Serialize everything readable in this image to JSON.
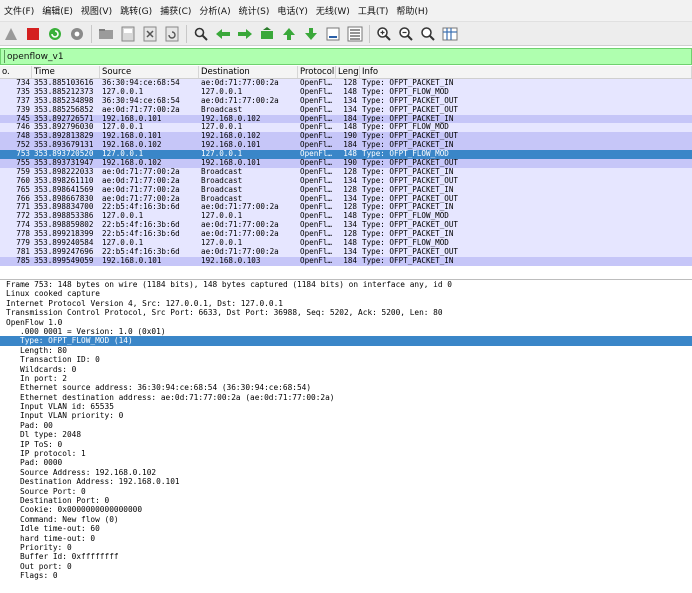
{
  "menubar": {
    "items": [
      "文件(F)",
      "编辑(E)",
      "视图(V)",
      "跳转(G)",
      "捕获(C)",
      "分析(A)",
      "统计(S)",
      "电话(Y)",
      "无线(W)",
      "工具(T)",
      "帮助(H)"
    ]
  },
  "toolbar": {
    "icons": [
      "shark-fin-icon",
      "stop-icon",
      "restart-icon",
      "options-icon",
      "open-icon",
      "save-icon",
      "close-file-icon",
      "reload-icon",
      "find-icon",
      "back-icon",
      "forward-icon",
      "goto-icon",
      "first-icon",
      "last-icon",
      "autoscroll-icon",
      "colorize-icon",
      "zoom-in-icon",
      "zoom-out-icon",
      "zoom-reset-icon",
      "resize-columns-icon"
    ]
  },
  "filter": {
    "value": "openflow_v1"
  },
  "packet_list": {
    "columns": [
      "o.",
      "Time",
      "Source",
      "Destination",
      "Protocol",
      "Length",
      "Info"
    ],
    "rows": [
      {
        "no": "734",
        "time": "353.885103616",
        "src": "36:30:94:ce:68:54",
        "dst": "ae:0d:71:77:00:2a",
        "proto": "OpenFl…",
        "len": "128",
        "info": "Type: OFPT_PACKET_IN",
        "style": "light"
      },
      {
        "no": "735",
        "time": "353.885212373",
        "src": "127.0.0.1",
        "dst": "127.0.0.1",
        "proto": "OpenFl…",
        "len": "148",
        "info": "Type: OFPT_FLOW_MOD",
        "style": "light"
      },
      {
        "no": "737",
        "time": "353.885234898",
        "src": "36:30:94:ce:68:54",
        "dst": "ae:0d:71:77:00:2a",
        "proto": "OpenFl…",
        "len": "134",
        "info": "Type: OFPT_PACKET_OUT",
        "style": "light"
      },
      {
        "no": "739",
        "time": "353.885256852",
        "src": "ae:0d:71:77:00:2a",
        "dst": "Broadcast",
        "proto": "OpenFl…",
        "len": "134",
        "info": "Type: OFPT_PACKET_OUT",
        "style": "light"
      },
      {
        "no": "745",
        "time": "353.892726571",
        "src": "192.168.0.101",
        "dst": "192.168.0.102",
        "proto": "OpenFl…",
        "len": "184",
        "info": "Type: OFPT_PACKET_IN",
        "style": "lav"
      },
      {
        "no": "746",
        "time": "353.892796030",
        "src": "127.0.0.1",
        "dst": "127.0.0.1",
        "proto": "OpenFl…",
        "len": "148",
        "info": "Type: OFPT_FLOW_MOD",
        "style": "light"
      },
      {
        "no": "748",
        "time": "353.892813829",
        "src": "192.168.0.101",
        "dst": "192.168.0.102",
        "proto": "OpenFl…",
        "len": "190",
        "info": "Type: OFPT_PACKET_OUT",
        "style": "lav"
      },
      {
        "no": "752",
        "time": "353.893679131",
        "src": "192.168.0.102",
        "dst": "192.168.0.101",
        "proto": "OpenFl…",
        "len": "184",
        "info": "Type: OFPT_PACKET_IN",
        "style": "lav"
      },
      {
        "no": "753",
        "time": "353.893720520",
        "src": "127.0.0.1",
        "dst": "127.0.0.1",
        "proto": "OpenFl…",
        "len": "148",
        "info": "Type: OFPT_FLOW_MOD",
        "style": "sel"
      },
      {
        "no": "755",
        "time": "353.893731947",
        "src": "192.168.0.102",
        "dst": "192.168.0.101",
        "proto": "OpenFl…",
        "len": "190",
        "info": "Type: OFPT_PACKET_OUT",
        "style": "lav"
      },
      {
        "no": "759",
        "time": "353.898222033",
        "src": "ae:0d:71:77:00:2a",
        "dst": "Broadcast",
        "proto": "OpenFl…",
        "len": "128",
        "info": "Type: OFPT_PACKET_IN",
        "style": "light"
      },
      {
        "no": "760",
        "time": "353.898261110",
        "src": "ae:0d:71:77:00:2a",
        "dst": "Broadcast",
        "proto": "OpenFl…",
        "len": "134",
        "info": "Type: OFPT_PACKET_OUT",
        "style": "light"
      },
      {
        "no": "765",
        "time": "353.898641569",
        "src": "ae:0d:71:77:00:2a",
        "dst": "Broadcast",
        "proto": "OpenFl…",
        "len": "128",
        "info": "Type: OFPT_PACKET_IN",
        "style": "light"
      },
      {
        "no": "766",
        "time": "353.898667830",
        "src": "ae:0d:71:77:00:2a",
        "dst": "Broadcast",
        "proto": "OpenFl…",
        "len": "134",
        "info": "Type: OFPT_PACKET_OUT",
        "style": "light"
      },
      {
        "no": "771",
        "time": "353.898834700",
        "src": "22:b5:4f:16:3b:6d",
        "dst": "ae:0d:71:77:00:2a",
        "proto": "OpenFl…",
        "len": "128",
        "info": "Type: OFPT_PACKET_IN",
        "style": "light"
      },
      {
        "no": "772",
        "time": "353.898853386",
        "src": "127.0.0.1",
        "dst": "127.0.0.1",
        "proto": "OpenFl…",
        "len": "148",
        "info": "Type: OFPT_FLOW_MOD",
        "style": "light"
      },
      {
        "no": "774",
        "time": "353.898859802",
        "src": "22:b5:4f:16:3b:6d",
        "dst": "ae:0d:71:77:00:2a",
        "proto": "OpenFl…",
        "len": "134",
        "info": "Type: OFPT_PACKET_OUT",
        "style": "light"
      },
      {
        "no": "778",
        "time": "353.899218399",
        "src": "22:b5:4f:16:3b:6d",
        "dst": "ae:0d:71:77:00:2a",
        "proto": "OpenFl…",
        "len": "128",
        "info": "Type: OFPT_PACKET_IN",
        "style": "light"
      },
      {
        "no": "779",
        "time": "353.899240584",
        "src": "127.0.0.1",
        "dst": "127.0.0.1",
        "proto": "OpenFl…",
        "len": "148",
        "info": "Type: OFPT_FLOW_MOD",
        "style": "light"
      },
      {
        "no": "781",
        "time": "353.899247696",
        "src": "22:b5:4f:16:3b:6d",
        "dst": "ae:0d:71:77:00:2a",
        "proto": "OpenFl…",
        "len": "134",
        "info": "Type: OFPT_PACKET_OUT",
        "style": "light"
      },
      {
        "no": "785",
        "time": "353.899549059",
        "src": "192.168.0.101",
        "dst": "192.168.0.103",
        "proto": "OpenFl…",
        "len": "184",
        "info": "Type: OFPT_PACKET_IN",
        "style": "lav"
      }
    ]
  },
  "details": {
    "lines": [
      {
        "text": "Frame 753: 148 bytes on wire (1184 bits), 148 bytes captured (1184 bits) on interface any, id 0",
        "indent": false,
        "sel": false
      },
      {
        "text": "Linux cooked capture",
        "indent": false,
        "sel": false
      },
      {
        "text": "Internet Protocol Version 4, Src: 127.0.0.1, Dst: 127.0.0.1",
        "indent": false,
        "sel": false
      },
      {
        "text": "Transmission Control Protocol, Src Port: 6633, Dst Port: 36988, Seq: 5202, Ack: 5200, Len: 80",
        "indent": false,
        "sel": false
      },
      {
        "text": "OpenFlow 1.0",
        "indent": false,
        "sel": false
      },
      {
        "text": ".000 0001 = Version: 1.0 (0x01)",
        "indent": true,
        "sel": false
      },
      {
        "text": "Type: OFPT_FLOW_MOD (14)",
        "indent": true,
        "sel": true
      },
      {
        "text": "Length: 80",
        "indent": true,
        "sel": false
      },
      {
        "text": "Transaction ID: 0",
        "indent": true,
        "sel": false
      },
      {
        "text": "Wildcards: 0",
        "indent": true,
        "sel": false
      },
      {
        "text": "In port: 2",
        "indent": true,
        "sel": false
      },
      {
        "text": "Ethernet source address: 36:30:94:ce:68:54 (36:30:94:ce:68:54)",
        "indent": true,
        "sel": false
      },
      {
        "text": "Ethernet destination address: ae:0d:71:77:00:2a (ae:0d:71:77:00:2a)",
        "indent": true,
        "sel": false
      },
      {
        "text": "Input VLAN id: 65535",
        "indent": true,
        "sel": false
      },
      {
        "text": "Input VLAN priority: 0",
        "indent": true,
        "sel": false
      },
      {
        "text": "Pad: 00",
        "indent": true,
        "sel": false
      },
      {
        "text": "Dl type: 2048",
        "indent": true,
        "sel": false
      },
      {
        "text": "IP ToS: 0",
        "indent": true,
        "sel": false
      },
      {
        "text": "IP protocol: 1",
        "indent": true,
        "sel": false
      },
      {
        "text": "Pad: 0000",
        "indent": true,
        "sel": false
      },
      {
        "text": "Source Address: 192.168.0.102",
        "indent": true,
        "sel": false
      },
      {
        "text": "Destination Address: 192.168.0.101",
        "indent": true,
        "sel": false
      },
      {
        "text": "Source Port: 0",
        "indent": true,
        "sel": false
      },
      {
        "text": "Destination Port: 0",
        "indent": true,
        "sel": false
      },
      {
        "text": "Cookie: 0x0000000000000000",
        "indent": true,
        "sel": false
      },
      {
        "text": "Command: New flow (0)",
        "indent": true,
        "sel": false
      },
      {
        "text": "Idle time-out: 60",
        "indent": true,
        "sel": false
      },
      {
        "text": "hard time-out: 0",
        "indent": true,
        "sel": false
      },
      {
        "text": "Priority: 0",
        "indent": true,
        "sel": false
      },
      {
        "text": "Buffer Id: 0xffffffff",
        "indent": true,
        "sel": false
      },
      {
        "text": "Out port: 0",
        "indent": true,
        "sel": false
      },
      {
        "text": "Flags: 0",
        "indent": true,
        "sel": false
      }
    ]
  },
  "colors": {
    "selection": "#3a86c8",
    "filter_ok": "#afffaf",
    "row_light": "#e6e6ff",
    "row_lavender": "#c6c6f8"
  }
}
